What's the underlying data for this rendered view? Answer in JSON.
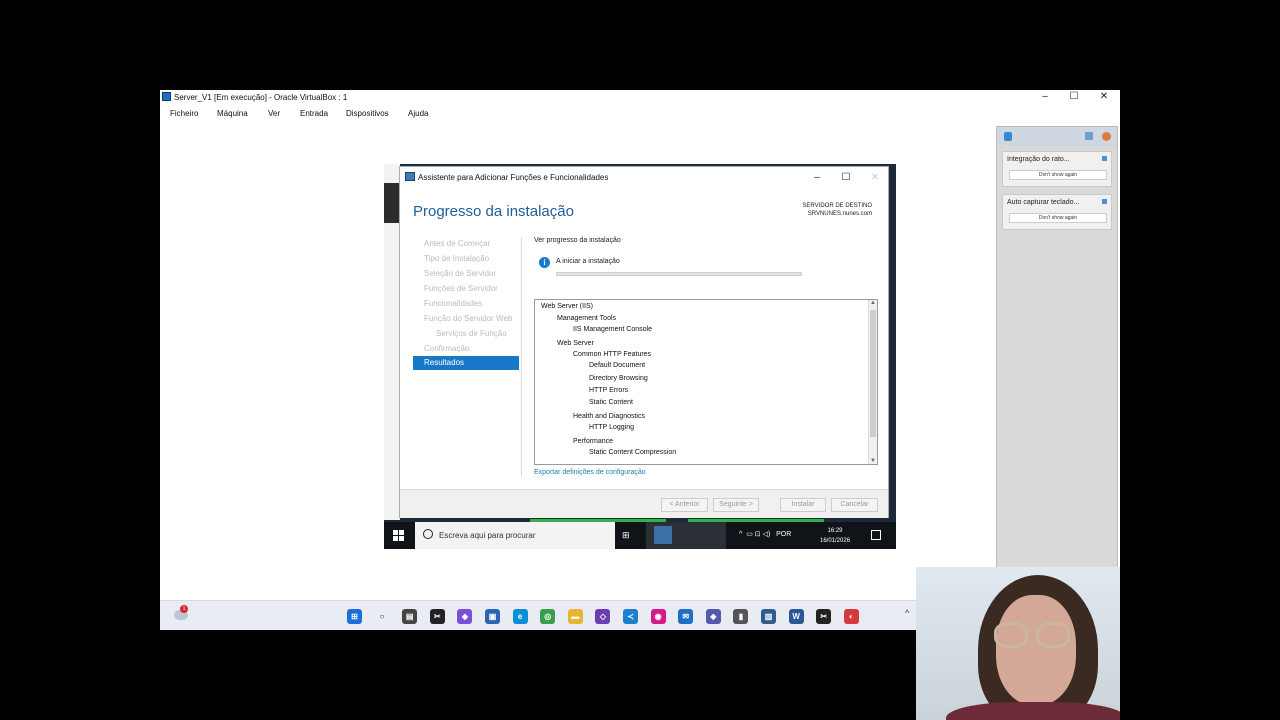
{
  "vbox": {
    "title": "Server_V1 [Em execução] - Oracle VirtualBox : 1",
    "controls": {
      "minimize": "–",
      "maximize": "☐",
      "close": "✕"
    },
    "menu": [
      "Ficheiro",
      "Máquina",
      "Ver",
      "Entrada",
      "Dispositivos",
      "Ajuda"
    ]
  },
  "wizard": {
    "title": "Assistente para Adicionar Funções e Funcionalidades",
    "controls": {
      "minimize": "–",
      "maximize": "☐",
      "close": "✕"
    },
    "heading": "Progresso da instalação",
    "destination_label": "SERVIDOR DE DESTINO",
    "destination_server": "SRVNUNES.nunes.com",
    "nav": [
      {
        "label": "Antes de Começar",
        "sub": false,
        "active": false
      },
      {
        "label": "Tipo de Instalação",
        "sub": false,
        "active": false
      },
      {
        "label": "Seleção de Servidor",
        "sub": false,
        "active": false
      },
      {
        "label": "Funções de Servidor",
        "sub": false,
        "active": false
      },
      {
        "label": "Funcionalidades",
        "sub": false,
        "active": false
      },
      {
        "label": "Função do Servidor Web",
        "sub": false,
        "active": false
      },
      {
        "label": "Serviços de Função",
        "sub": true,
        "active": false
      },
      {
        "label": "Confirmação",
        "sub": false,
        "active": false
      },
      {
        "label": "Resultados",
        "sub": false,
        "active": true
      }
    ],
    "progress_label": "Ver progresso da instalação",
    "status": "A iniciar a instalação",
    "progress_fraction": 0.0,
    "tree": [
      {
        "text": "Web Server (IIS)",
        "level": 0
      },
      {
        "text": "Management Tools",
        "level": 1
      },
      {
        "text": "IIS Management Console",
        "level": 2
      },
      {
        "text": "Web Server",
        "level": 1
      },
      {
        "text": "Common HTTP Features",
        "level": 2
      },
      {
        "text": "Default Document",
        "level": 3
      },
      {
        "text": "Directory Browsing",
        "level": 3
      },
      {
        "text": "HTTP Errors",
        "level": 3
      },
      {
        "text": "Static Content",
        "level": 3
      },
      {
        "text": "Health and Diagnostics",
        "level": 2
      },
      {
        "text": "HTTP Logging",
        "level": 3
      },
      {
        "text": "Performance",
        "level": 2
      },
      {
        "text": "Static Content Compression",
        "level": 3
      }
    ],
    "export_link": "Exportar definições de configuração",
    "buttons": {
      "previous": "< Anterior",
      "next": "Seguinte >",
      "install": "Instalar",
      "cancel": "Cancelar"
    }
  },
  "guest_taskbar": {
    "search_placeholder": "Escreva aqui para procurar",
    "language": "POR",
    "time": "16:29",
    "date": "16/01/2026"
  },
  "notifications": [
    {
      "title": "Integração do rato...",
      "button": "Don't show again"
    },
    {
      "title": "Auto capturar teclado...",
      "button": "Don't show again"
    }
  ],
  "host_taskbar": {
    "weather_badge": "1",
    "icons": [
      "windows-start-icon",
      "search-icon",
      "file-explorer-icon",
      "capcut-icon",
      "copilot-icon",
      "microsoft-store-icon",
      "edge-icon",
      "chrome-icon",
      "folder-icon",
      "visual-studio-icon",
      "vscode-icon",
      "app-icon",
      "outlook-icon",
      "teams-icon",
      "app-icon-2",
      "virtualbox-icon",
      "word-icon",
      "capcut-icon-2",
      "app-icon-3"
    ],
    "tray_chevron": "^"
  }
}
